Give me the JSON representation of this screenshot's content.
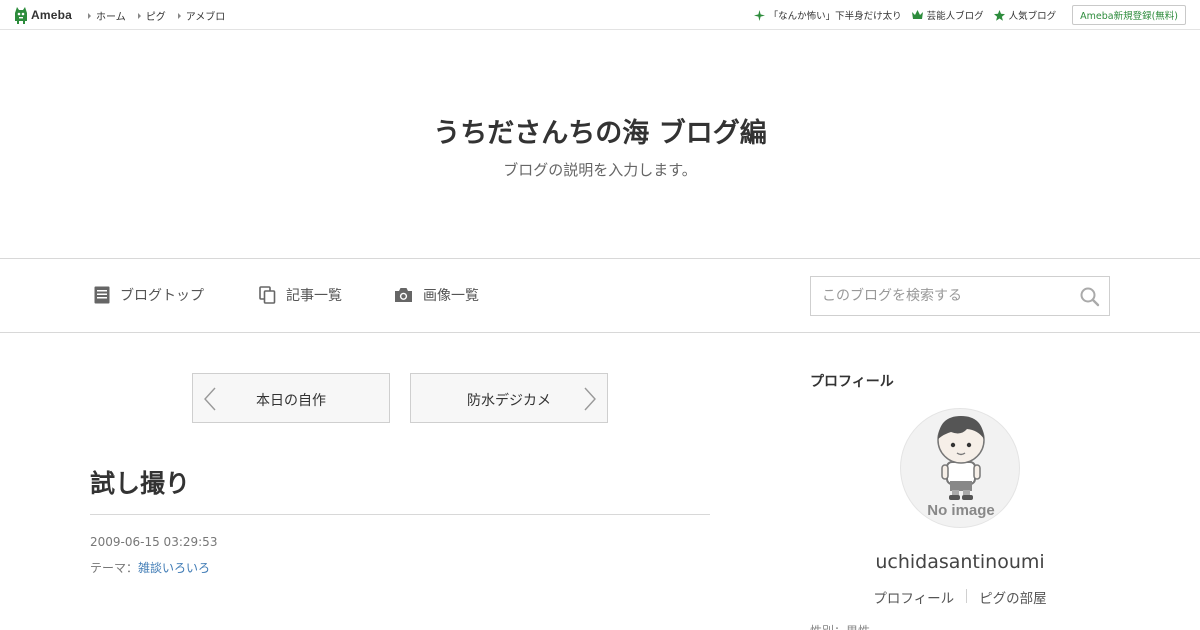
{
  "header": {
    "logo_text": "Ameba",
    "nav": [
      {
        "label": "ホーム"
      },
      {
        "label": "ピグ"
      },
      {
        "label": "アメブロ"
      }
    ],
    "right": [
      {
        "label": "「なんか怖い」下半身だけ太り",
        "icon": "sparkle-icon"
      },
      {
        "label": "芸能人ブログ",
        "icon": "crown-icon"
      },
      {
        "label": "人気ブログ",
        "icon": "star-icon"
      }
    ],
    "signup_label": "Ameba新規登録(無料)"
  },
  "blog": {
    "title": "うちださんちの海 ブログ編",
    "description": "ブログの説明を入力します。"
  },
  "blog_nav": {
    "items": [
      {
        "label": "ブログトップ",
        "icon": "document-icon"
      },
      {
        "label": "記事一覧",
        "icon": "copy-icon"
      },
      {
        "label": "画像一覧",
        "icon": "camera-icon"
      }
    ],
    "search_placeholder": "このブログを検索する"
  },
  "pager": {
    "prev_label": "本日の自作",
    "next_label": "防水デジカメ"
  },
  "entry": {
    "title": "試し撮り",
    "date": "2009-06-15 03:29:53",
    "theme_prefix": "テーマ：",
    "theme_link": "雑談いろいろ"
  },
  "sidebar": {
    "heading": "プロフィール",
    "avatar_text": "No image",
    "profile_name": "uchidasantinoumi",
    "links": [
      "プロフィール",
      "ピグの部屋"
    ],
    "cut_text": "性別：男性"
  },
  "colors": {
    "brand_green": "#2d8c3c",
    "link_blue": "#3f7bb5"
  }
}
